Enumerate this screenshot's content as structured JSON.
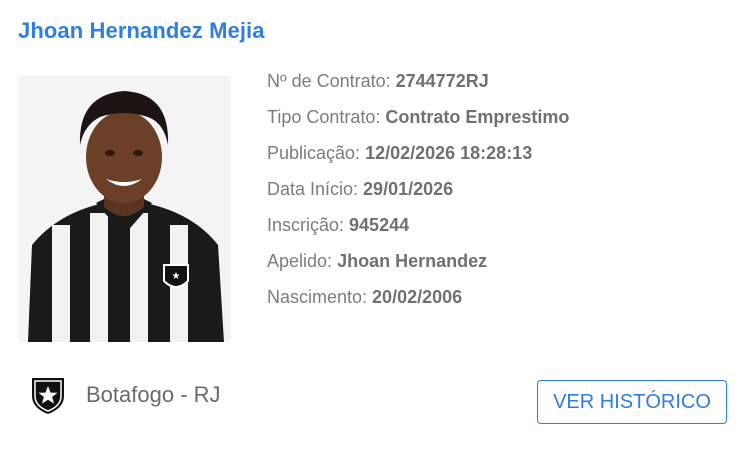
{
  "player": {
    "name": "Jhoan Hernandez Mejia"
  },
  "details": [
    {
      "label": "Nº de Contrato: ",
      "value": "2744772RJ"
    },
    {
      "label": "Tipo Contrato: ",
      "value": "Contrato Emprestimo"
    },
    {
      "label": "Publicação: ",
      "value": "12/02/2026 18:28:13"
    },
    {
      "label": "Data Início: ",
      "value": "29/01/2026"
    },
    {
      "label": "Inscrição: ",
      "value": "945244"
    },
    {
      "label": "Apelido: ",
      "value": "Jhoan Hernandez"
    },
    {
      "label": "Nascimento: ",
      "value": "20/02/2006"
    }
  ],
  "club": {
    "name": "Botafogo - RJ",
    "logo_icon": "botafogo-star-shield-icon"
  },
  "actions": {
    "history_label": "VER HISTÓRICO"
  },
  "colors": {
    "accent": "#2f7de1",
    "text": "#7c7c7c"
  }
}
